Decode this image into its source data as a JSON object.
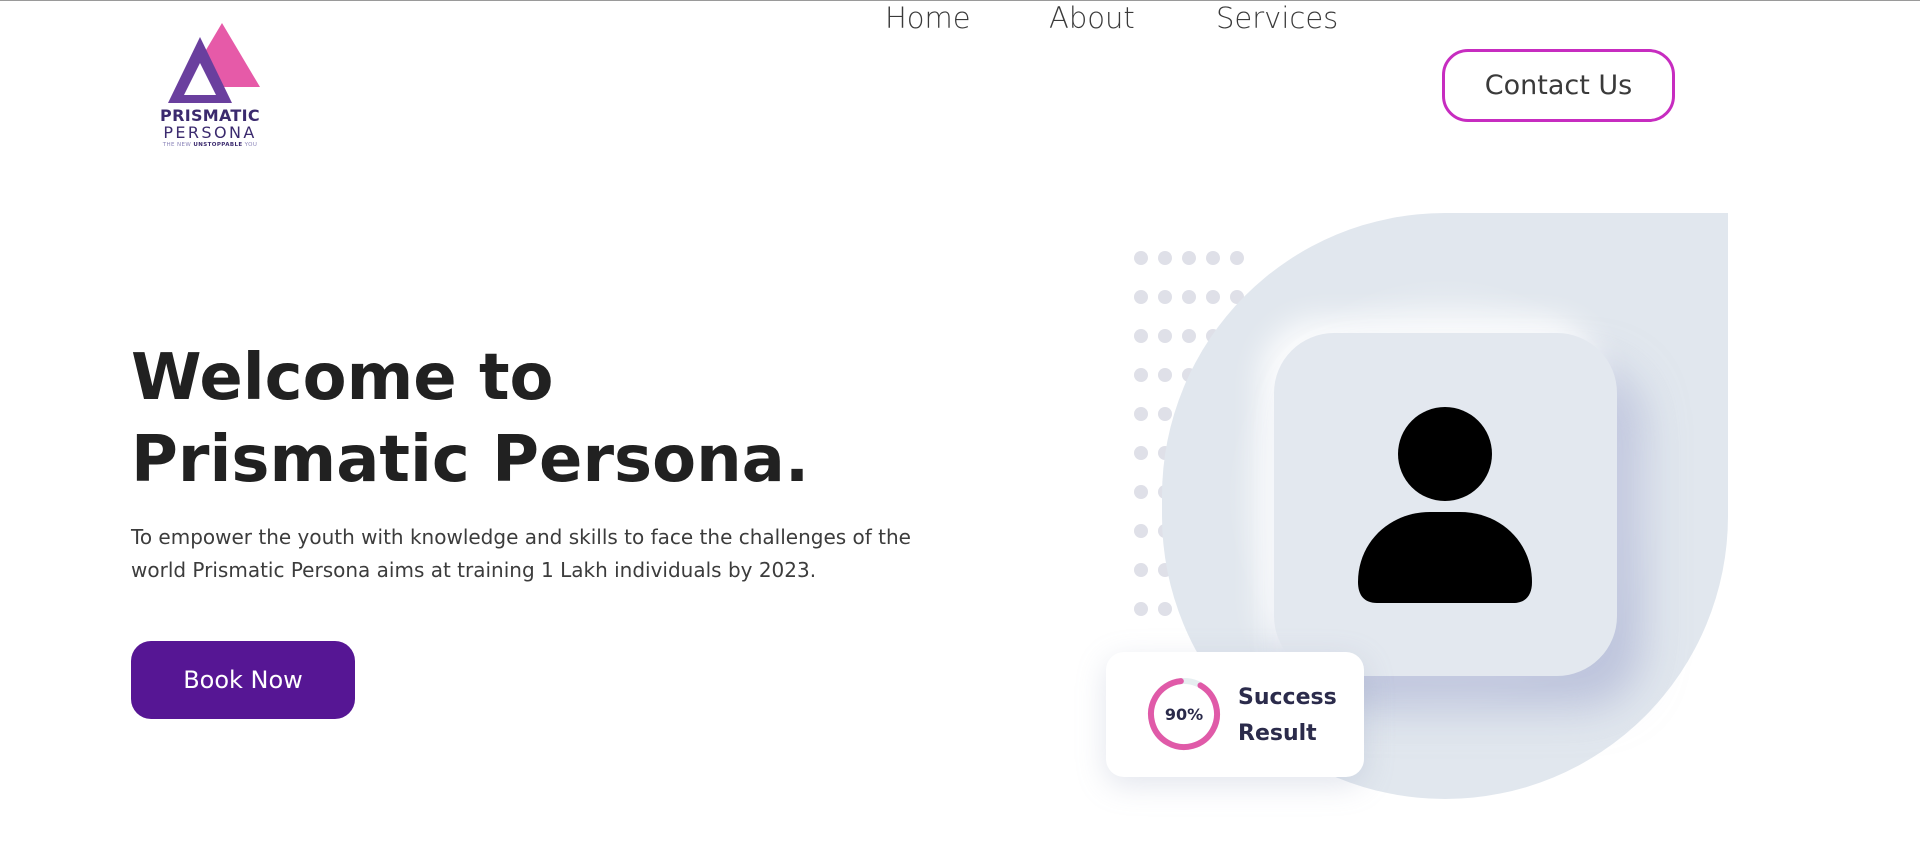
{
  "logo": {
    "word1": "PRISMATIC",
    "word2": "PERSONA",
    "tagline_pre": "THE NEW ",
    "tagline_bold": "UNSTOPPABLE",
    "tagline_post": " YOU"
  },
  "nav": {
    "items": [
      {
        "label": "Home"
      },
      {
        "label": "About"
      },
      {
        "label": "Services"
      }
    ],
    "contact_label": "Contact Us"
  },
  "hero": {
    "title_line1": "Welcome to",
    "title_line2": "Prismatic Persona.",
    "description": "To empower the youth with knowledge and skills to face the challenges of the world Prismatic Persona aims at training 1 Lakh individuals by 2023.",
    "cta_label": "Book Now"
  },
  "stat_card": {
    "percent_label": "90%",
    "percent_value": 90,
    "line1": "Success",
    "line2": "Result"
  },
  "colors": {
    "brand_purple": "#561694",
    "contact_border": "#c72cc0",
    "ring_pink": "#e05aa8",
    "logo_pink": "#e65aa8",
    "logo_purple": "#6a3f9e"
  }
}
